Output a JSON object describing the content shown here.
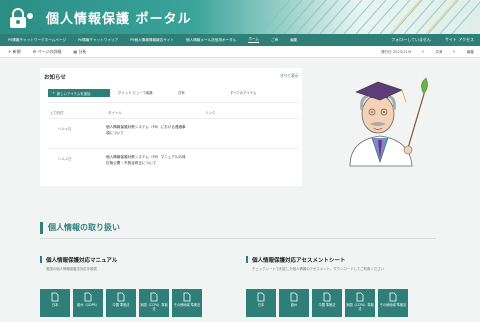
{
  "header": {
    "site_title": "個人情報保護 ポータル"
  },
  "nav": {
    "items": [
      "PII情報チャットワークホームページ",
      "PII情報チャットワイリア",
      "PII個人情報情報報告サイト",
      "個人情報メール送信用ポータル",
      "ホーム",
      "ご声",
      "編集"
    ],
    "active_index": 4,
    "follow": "フォローしていません",
    "site_access": "サイト アクセス"
  },
  "cmdbar": {
    "new": "新規",
    "page_details": "ページの詳細",
    "analytics": "分析",
    "published": "発行日 2023/11/9",
    "share": "共有",
    "edit": "編集"
  },
  "news": {
    "title": "お知らせ",
    "show_all": "すべて表示",
    "add_button": "新しいアイテムを追加",
    "toolbar": [
      "グリッド ビューで編集",
      "共有",
      "すべてのアイテム"
    ],
    "columns": [
      "入力日付",
      "タイトル",
      "リンク"
    ],
    "rows": [
      {
        "date": "ヘルメ日",
        "title": "個人情報保護対策システム（PII）における連絡事項について"
      },
      {
        "date": "ヘルメ日",
        "title": "個人情報保護対策システム（PII）マニュアルの改訂版公開・不具合修正について"
      }
    ]
  },
  "handling": {
    "title": "個人情報の取り扱い",
    "manual": {
      "title": "個人情報保護対応マニュアル",
      "desc": "各国の個人情報保護法対応手順書",
      "tiles": [
        "日本",
        "欧州（GDPR）",
        "中国 準拠法",
        "米国（CCPA）準拠法",
        "その他地域 準拠法"
      ]
    },
    "assessment": {
      "title": "個人情報保護対応アセスメントシート",
      "desc": "チェックシートで判定した個人情報のアセスメント、ダウンロードしてご利用ください",
      "tiles": [
        "日本",
        "欧州",
        "中国 準拠法",
        "米国（CCPA）準拠法",
        "その他地域 準拠法"
      ]
    }
  },
  "colors": {
    "accent": "#2e7f78",
    "banner_light": "#e9f4f1"
  },
  "icons": [
    "lock-logo-icon",
    "plus-icon",
    "document-icon",
    "mascot-professor-illustration"
  ]
}
